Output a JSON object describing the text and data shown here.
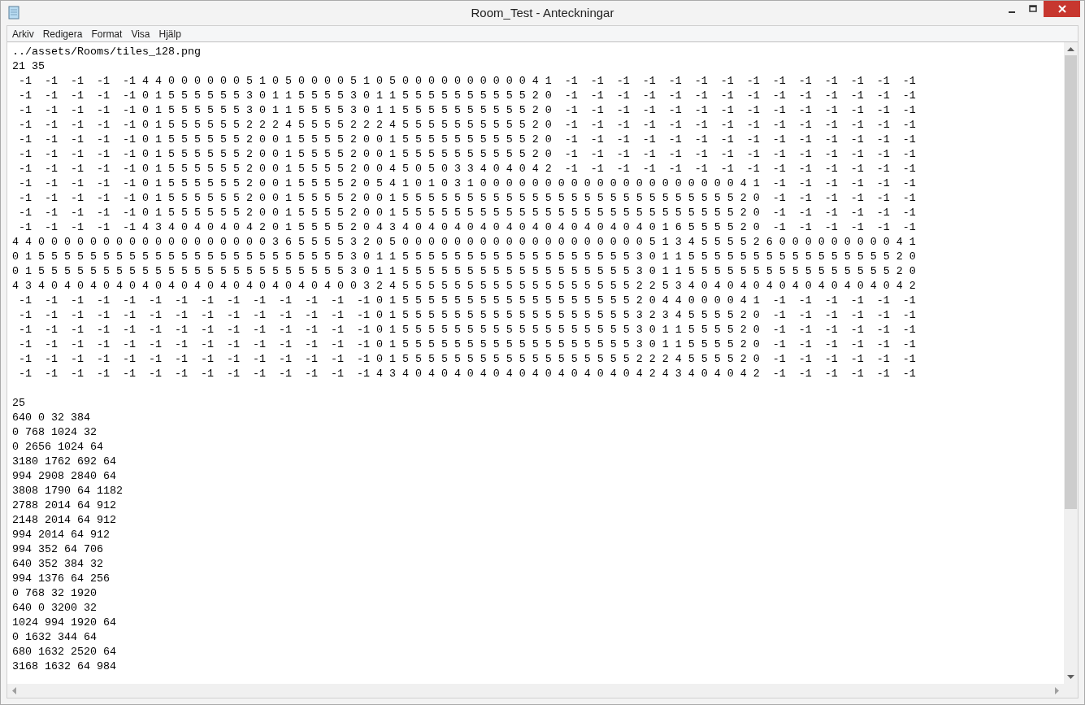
{
  "window": {
    "title": "Room_Test - Anteckningar"
  },
  "menu": [
    "Arkiv",
    "Redigera",
    "Format",
    "Visa",
    "Hjälp"
  ],
  "editor": {
    "path": "../assets/Rooms/tiles_128.png",
    "size": "21 35",
    "grid": [
      " -1  -1  -1  -1  -1 4 4 0 0 0 0 0 0 5 1 0 5 0 0 0 0 5 1 0 5 0 0 0 0 0 0 0 0 0 0 4 1  -1  -1  -1  -1  -1  -1  -1  -1  -1  -1  -1  -1  -1  -1",
      " -1  -1  -1  -1  -1 0 1 5 5 5 5 5 5 3 0 1 1 5 5 5 5 3 0 1 1 5 5 5 5 5 5 5 5 5 5 2 0  -1  -1  -1  -1  -1  -1  -1  -1  -1  -1  -1  -1  -1  -1",
      " -1  -1  -1  -1  -1 0 1 5 5 5 5 5 5 3 0 1 1 5 5 5 5 3 0 1 1 5 5 5 5 5 5 5 5 5 5 2 0  -1  -1  -1  -1  -1  -1  -1  -1  -1  -1  -1  -1  -1  -1",
      " -1  -1  -1  -1  -1 0 1 5 5 5 5 5 5 2 2 2 4 5 5 5 5 2 2 2 4 5 5 5 5 5 5 5 5 5 5 2 0  -1  -1  -1  -1  -1  -1  -1  -1  -1  -1  -1  -1  -1  -1",
      " -1  -1  -1  -1  -1 0 1 5 5 5 5 5 5 2 0 0 1 5 5 5 5 2 0 0 1 5 5 5 5 5 5 5 5 5 5 2 0  -1  -1  -1  -1  -1  -1  -1  -1  -1  -1  -1  -1  -1  -1",
      " -1  -1  -1  -1  -1 0 1 5 5 5 5 5 5 2 0 0 1 5 5 5 5 2 0 0 1 5 5 5 5 5 5 5 5 5 5 2 0  -1  -1  -1  -1  -1  -1  -1  -1  -1  -1  -1  -1  -1  -1",
      " -1  -1  -1  -1  -1 0 1 5 5 5 5 5 5 2 0 0 1 5 5 5 5 2 0 0 4 5 0 5 0 3 3 4 0 4 0 4 2  -1  -1  -1  -1  -1  -1  -1  -1  -1  -1  -1  -1  -1  -1",
      " -1  -1  -1  -1  -1 0 1 5 5 5 5 5 5 2 0 0 1 5 5 5 5 2 0 5 4 1 0 1 0 3 1 0 0 0 0 0 0 0 0 0 0 0 0 0 0 0 0 0 0 0 0 4 1  -1  -1  -1  -1  -1  -1",
      " -1  -1  -1  -1  -1 0 1 5 5 5 5 5 5 2 0 0 1 5 5 5 5 2 0 0 1 5 5 5 5 5 5 5 5 5 5 5 5 5 5 5 5 5 5 5 5 5 5 5 5 5 5 2 0  -1  -1  -1  -1  -1  -1",
      " -1  -1  -1  -1  -1 0 1 5 5 5 5 5 5 2 0 0 1 5 5 5 5 2 0 0 1 5 5 5 5 5 5 5 5 5 5 5 5 5 5 5 5 5 5 5 5 5 5 5 5 5 5 2 0  -1  -1  -1  -1  -1  -1",
      " -1  -1  -1  -1  -1 4 3 4 0 4 0 4 0 4 2 0 1 5 5 5 5 2 0 4 3 4 0 4 0 4 0 4 0 4 0 4 0 4 0 4 0 4 0 4 0 1 6 5 5 5 5 2 0  -1  -1  -1  -1  -1  -1",
      "4 4 0 0 0 0 0 0 0 0 0 0 0 0 0 0 0 0 0 0 3 6 5 5 5 5 3 2 0 5 0 0 0 0 0 0 0 0 0 0 0 0 0 0 0 0 0 0 0 5 1 3 4 5 5 5 5 2 6 0 0 0 0 0 0 0 0 0 4 1",
      "0 1 5 5 5 5 5 5 5 5 5 5 5 5 5 5 5 5 5 5 5 5 5 5 5 5 3 0 1 1 5 5 5 5 5 5 5 5 5 5 5 5 5 5 5 5 5 5 3 0 1 1 5 5 5 5 5 5 5 5 5 5 5 5 5 5 5 5 2 0",
      "0 1 5 5 5 5 5 5 5 5 5 5 5 5 5 5 5 5 5 5 5 5 5 5 5 5 3 0 1 1 5 5 5 5 5 5 5 5 5 5 5 5 5 5 5 5 5 5 3 0 1 1 5 5 5 5 5 5 5 5 5 5 5 5 5 5 5 5 2 0",
      "4 3 4 0 4 0 4 0 4 0 4 0 4 0 4 0 4 0 4 0 4 0 4 0 4 0 0 3 2 4 5 5 5 5 5 5 5 5 5 5 5 5 5 5 5 5 5 5 2 2 5 3 4 0 4 0 4 0 4 0 4 0 4 0 4 0 4 0 4 2",
      " -1  -1  -1  -1  -1  -1  -1  -1  -1  -1  -1  -1  -1  -1 0 1 5 5 5 5 5 5 5 5 5 5 5 5 5 5 5 5 5 5 2 0 4 4 0 0 0 0 4 1  -1  -1  -1  -1  -1  -1",
      " -1  -1  -1  -1  -1  -1  -1  -1  -1  -1  -1  -1  -1  -1 0 1 5 5 5 5 5 5 5 5 5 5 5 5 5 5 5 5 5 5 3 2 3 4 5 5 5 5 2 0  -1  -1  -1  -1  -1  -1",
      " -1  -1  -1  -1  -1  -1  -1  -1  -1  -1  -1  -1  -1  -1 0 1 5 5 5 5 5 5 5 5 5 5 5 5 5 5 5 5 5 5 3 0 1 1 5 5 5 5 2 0  -1  -1  -1  -1  -1  -1",
      " -1  -1  -1  -1  -1  -1  -1  -1  -1  -1  -1  -1  -1  -1 0 1 5 5 5 5 5 5 5 5 5 5 5 5 5 5 5 5 5 5 3 0 1 1 5 5 5 5 2 0  -1  -1  -1  -1  -1  -1",
      " -1  -1  -1  -1  -1  -1  -1  -1  -1  -1  -1  -1  -1  -1 0 1 5 5 5 5 5 5 5 5 5 5 5 5 5 5 5 5 5 5 2 2 2 4 5 5 5 5 2 0  -1  -1  -1  -1  -1  -1",
      " -1  -1  -1  -1  -1  -1  -1  -1  -1  -1  -1  -1  -1  -1 4 3 4 0 4 0 4 0 4 0 4 0 4 0 4 0 4 0 4 0 4 2 4 3 4 0 4 0 4 2  -1  -1  -1  -1  -1  -1"
    ],
    "rect_count": "25",
    "rects": [
      "640 0 32 384",
      "0 768 1024 32",
      "0 2656 1024 64",
      "3180 1762 692 64",
      "994 2908 2840 64",
      "3808 1790 64 1182",
      "2788 2014 64 912",
      "2148 2014 64 912",
      "994 2014 64 912",
      "994 352 64 706",
      "640 352 384 32",
      "994 1376 64 256",
      "0 768 32 1920",
      "640 0 3200 32",
      "1024 994 1920 64",
      "0 1632 344 64",
      "680 1632 2520 64",
      "3168 1632 64 984"
    ]
  }
}
